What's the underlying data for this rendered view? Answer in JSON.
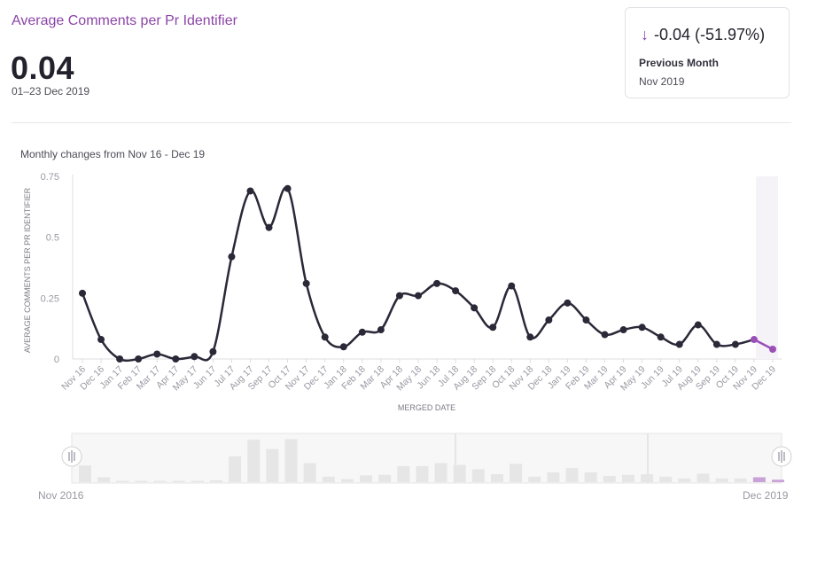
{
  "header": {
    "title": "Average Comments per Pr Identifier",
    "value": "0.04",
    "date_range": "01–23 Dec 2019"
  },
  "comparison_card": {
    "change": "-0.04 (-51.97%)",
    "direction_icon": "arrow-down-icon",
    "label": "Previous Month",
    "period": "Nov 2019"
  },
  "chart_subtitle": "Monthly changes from Nov 16 - Dec 19",
  "colors": {
    "line": "#2b2838",
    "highlight": "#9b4fb8",
    "title": "#8c44a8",
    "brush_bar": "#e6e6e6"
  },
  "chart_data": {
    "type": "line",
    "xlabel": "MERGED DATE",
    "ylabel": "AVERAGE COMMENTS PER PR IDENTIFIER",
    "ylim": [
      0,
      0.75
    ],
    "yticks": [
      "0",
      "0.25",
      "0.5",
      "0.75"
    ],
    "grid": false,
    "categories": [
      "Nov 16",
      "Dec 16",
      "Jan 17",
      "Feb 17",
      "Mar 17",
      "Apr 17",
      "May 17",
      "Jun 17",
      "Jul 17",
      "Aug 17",
      "Sep 17",
      "Oct 17",
      "Nov 17",
      "Dec 17",
      "Jan 18",
      "Feb 18",
      "Mar 18",
      "Apr 18",
      "May 18",
      "Jun 18",
      "Jul 18",
      "Aug 18",
      "Sep 18",
      "Oct 18",
      "Nov 18",
      "Dec 18",
      "Jan 19",
      "Feb 19",
      "Mar 19",
      "Apr 19",
      "May 19",
      "Jun 19",
      "Jul 19",
      "Aug 19",
      "Sep 19",
      "Oct 19",
      "Nov 19",
      "Dec 19"
    ],
    "values": [
      0.27,
      0.08,
      0.0,
      0.0,
      0.02,
      0.0,
      0.01,
      0.03,
      0.42,
      0.69,
      0.54,
      0.7,
      0.31,
      0.09,
      0.05,
      0.11,
      0.12,
      0.26,
      0.26,
      0.31,
      0.28,
      0.21,
      0.13,
      0.3,
      0.09,
      0.16,
      0.23,
      0.16,
      0.1,
      0.12,
      0.13,
      0.09,
      0.06,
      0.14,
      0.06,
      0.06,
      0.08,
      0.04
    ],
    "highlight_from_index": 36
  },
  "brush": {
    "start_label": "Nov 2016",
    "end_label": "Dec 2019"
  }
}
